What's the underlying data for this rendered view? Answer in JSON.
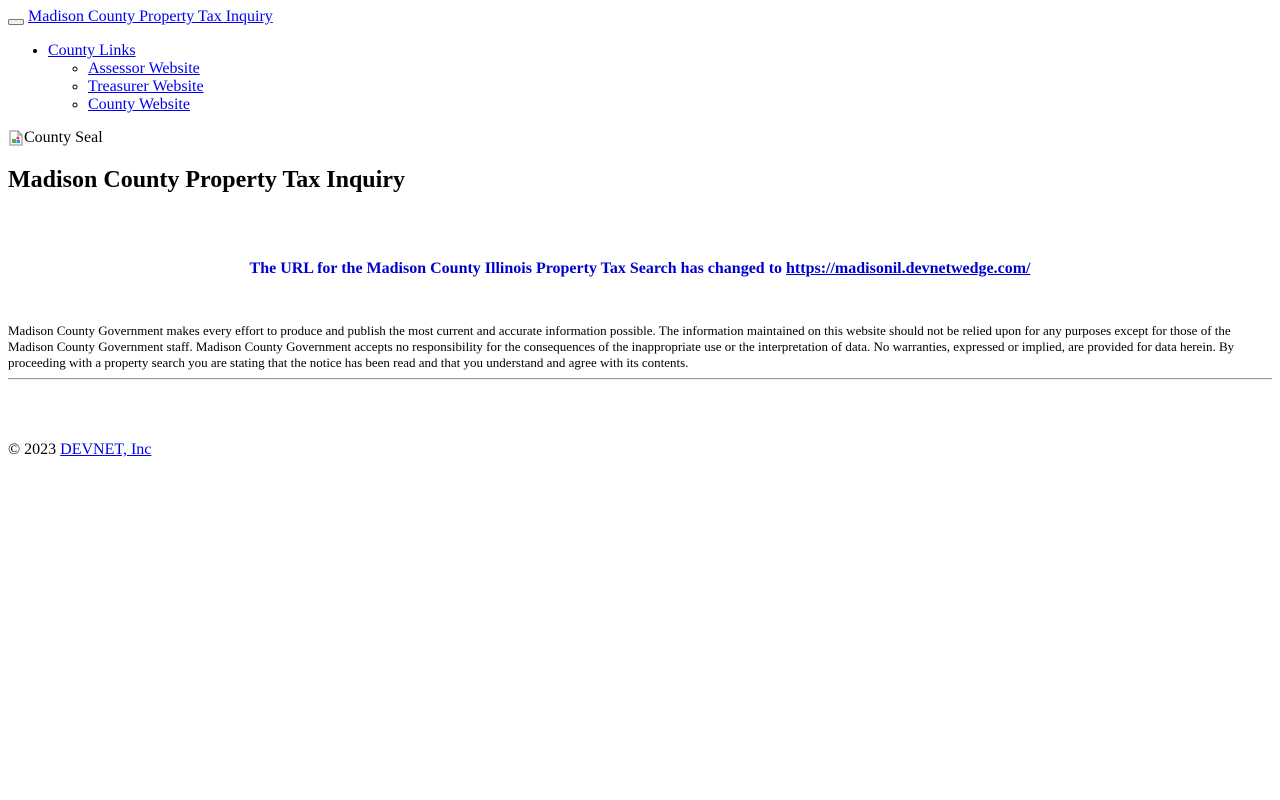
{
  "header": {
    "brand_label": "Madison County Property Tax Inquiry"
  },
  "nav": {
    "county_links_label": "County Links",
    "items": [
      {
        "label": "Assessor Website"
      },
      {
        "label": "Treasurer Website"
      },
      {
        "label": "County Website"
      }
    ]
  },
  "seal": {
    "alt_text": "County Seal"
  },
  "main": {
    "title": "Madison County Property Tax Inquiry",
    "notice_text": "The URL for the Madison County Illinois Property Tax Search has changed to ",
    "notice_link": "https://madisonil.devnetwedge.com/",
    "notice_color": "#0000cc",
    "disclaimer": "Madison County Government makes every effort to produce and publish the most current and accurate information possible. The information maintained on this website should not be relied upon for any purposes except for those of the Madison County Government staff. Madison County Government accepts no responsibility for the consequences of the inappropriate use or the interpretation of data. No warranties, expressed or implied, are provided for data herein. By proceeding with a property search you are stating that the notice has been read and that you understand and agree with its contents."
  },
  "footer": {
    "copyright": "© 2023 ",
    "company_link": "DEVNET, Inc"
  },
  "colors": {
    "link": "#0000ee"
  }
}
